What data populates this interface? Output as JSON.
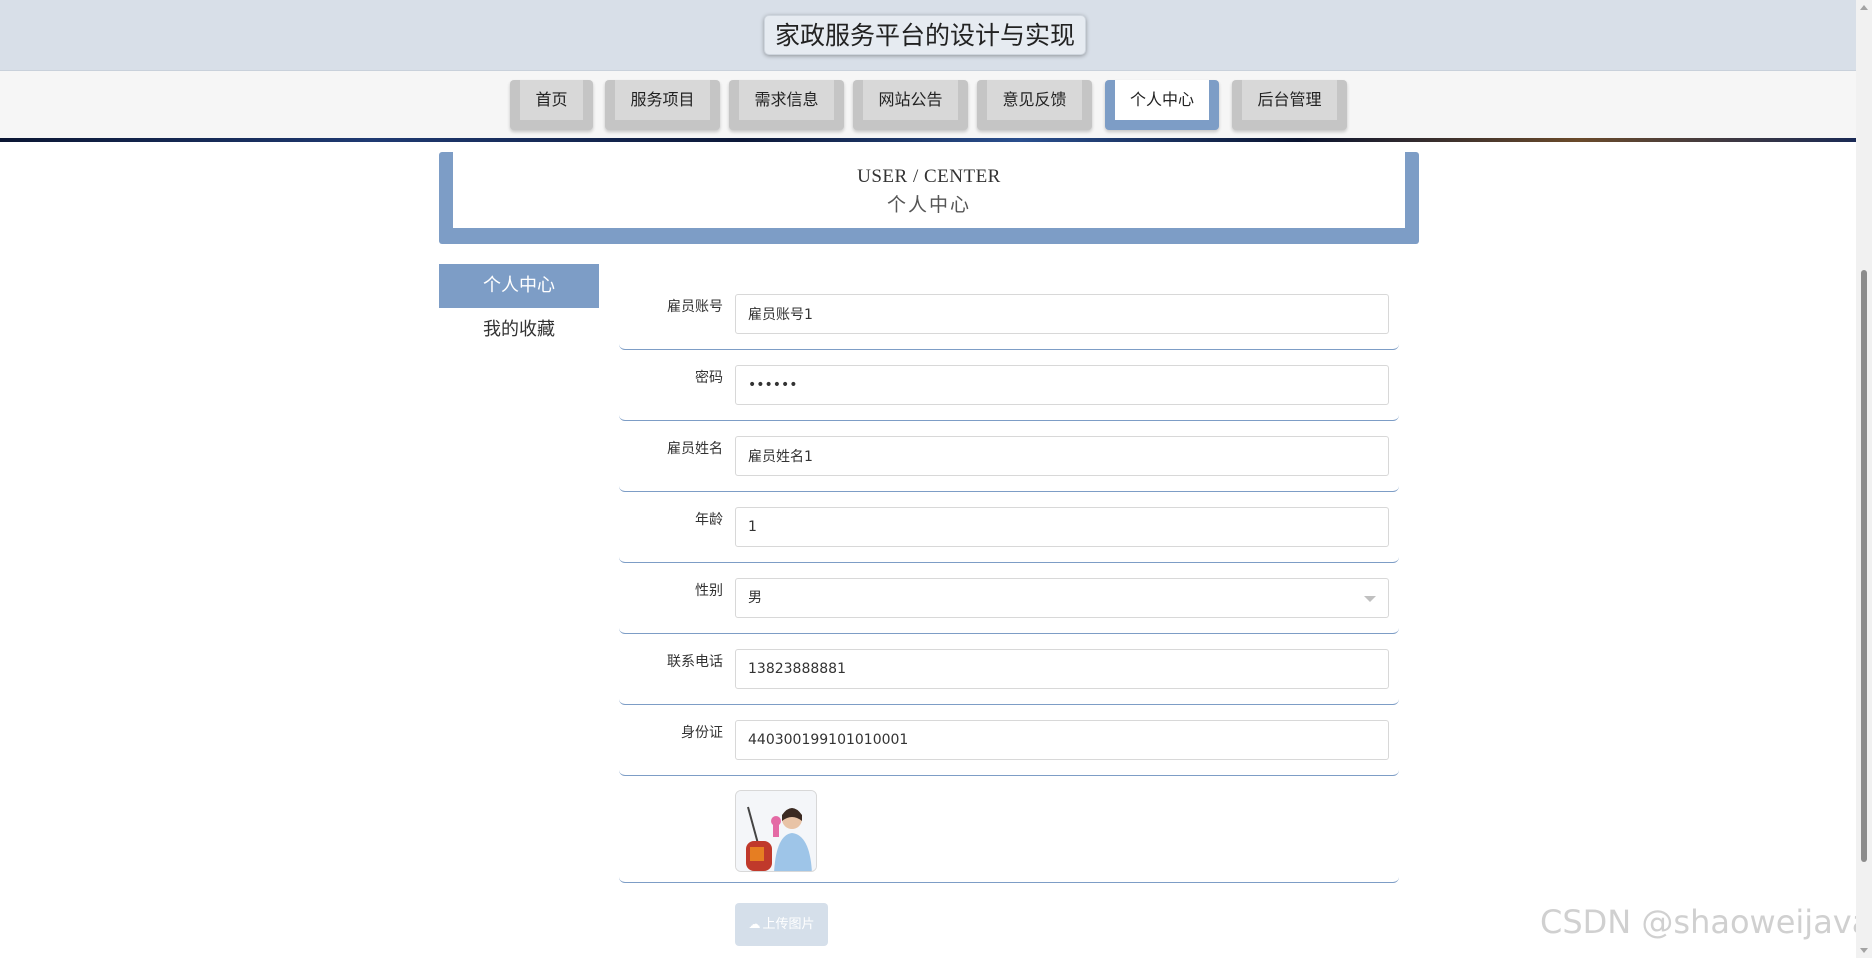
{
  "header": {
    "title": "家政服务平台的设计与实现"
  },
  "nav": {
    "items": [
      {
        "label": "首页"
      },
      {
        "label": "服务项目"
      },
      {
        "label": "需求信息"
      },
      {
        "label": "网站公告"
      },
      {
        "label": "意见反馈"
      },
      {
        "label": "个人中心",
        "active": true
      },
      {
        "label": "后台管理"
      }
    ]
  },
  "section": {
    "title_en": "USER / CENTER",
    "title_cn": "个人中心"
  },
  "side_menu": {
    "items": [
      {
        "label": "个人中心",
        "active": true
      },
      {
        "label": "我的收藏"
      }
    ]
  },
  "form": {
    "account": {
      "label": "雇员账号",
      "value": "雇员账号1"
    },
    "password": {
      "label": "密码",
      "value": "••••••"
    },
    "name": {
      "label": "雇员姓名",
      "value": "雇员姓名1"
    },
    "age": {
      "label": "年龄",
      "value": "1"
    },
    "gender": {
      "label": "性别",
      "value": "男"
    },
    "phone": {
      "label": "联系电话",
      "value": "13823888881"
    },
    "id_card": {
      "label": "身份证",
      "value": "440300199101010001"
    },
    "upload_label": "上传图片"
  },
  "watermark": "CSDN @shaoweijava",
  "colors": {
    "accent": "#7d9dc6",
    "header_bg": "#d8dfe8",
    "nav_tab": "#c5c5c5"
  },
  "icons": {
    "upload": "cloud-upload-icon",
    "select": "chevron-down-icon"
  }
}
